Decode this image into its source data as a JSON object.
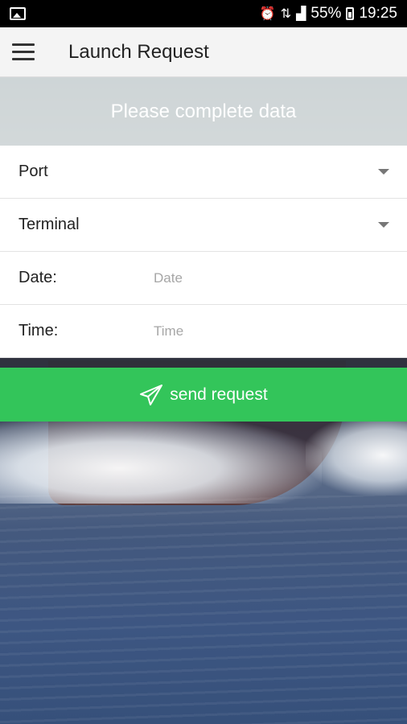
{
  "status_bar": {
    "battery": "55%",
    "time": "19:25",
    "icons": [
      "image-icon",
      "alarm-icon",
      "data-icon",
      "signal-icon",
      "battery-icon"
    ]
  },
  "app_bar": {
    "title": "Launch Request",
    "menu_icon": "hamburger-menu-icon"
  },
  "banner": {
    "text": "Please complete data"
  },
  "form": {
    "port": {
      "label": "Port"
    },
    "terminal": {
      "label": "Terminal"
    },
    "date": {
      "label": "Date:",
      "placeholder": "Date",
      "value": ""
    },
    "time": {
      "label": "Time:",
      "placeholder": "Time",
      "value": ""
    }
  },
  "send_button": {
    "label": "send request",
    "icon": "paper-plane-icon",
    "color": "#33c55a"
  }
}
